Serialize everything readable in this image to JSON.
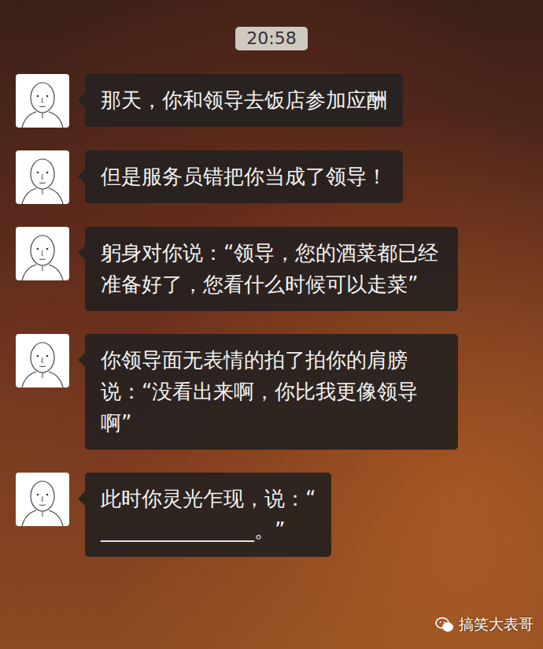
{
  "time": "20:58",
  "messages": [
    {
      "text": "那天，你和领导去饭店参加应酬"
    },
    {
      "text": "但是服务员错把你当成了领导！"
    },
    {
      "text": "躬身对你说：“领导，您的酒菜都已经准备好了，您看什么时候可以走菜”"
    },
    {
      "text": "你领导面无表情的拍了拍你的肩膀说：“没看出来啊，你比我更像领导啊”"
    },
    {
      "text": "此时你灵光乍现，说：“\n_______________。”"
    }
  ],
  "watermark": {
    "text": "搞笑大表哥"
  }
}
